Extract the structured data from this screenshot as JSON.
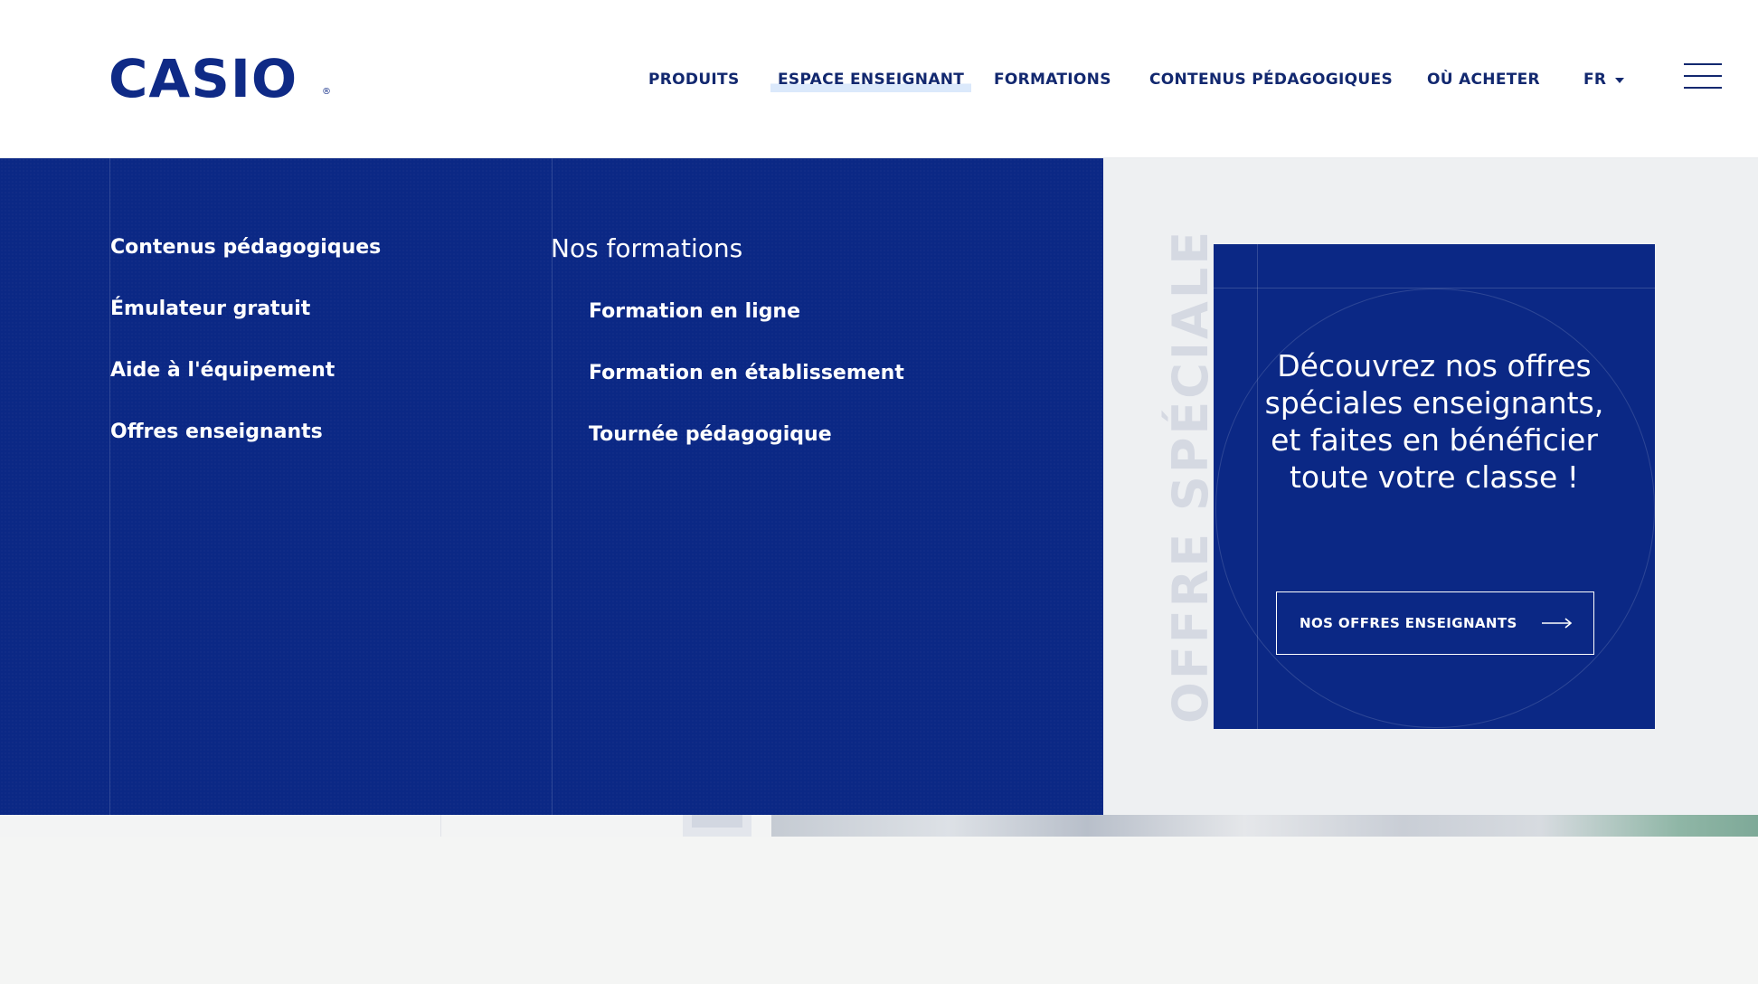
{
  "header": {
    "logo_text": "CASIO",
    "logo_mark": "®",
    "nav": {
      "produits": "PRODUITS",
      "espace_enseignant": "ESPACE ENSEIGNANT",
      "formations": "FORMATIONS",
      "contenus": "CONTENUS PÉDAGOGIQUES",
      "ou_acheter": "OÙ ACHETER",
      "lang": "FR"
    },
    "icons": {
      "lang_caret": "chevron-down-icon",
      "menu": "hamburger-menu-icon"
    }
  },
  "menu": {
    "column1": {
      "contenus": "Contenus pédagogiques",
      "emulateur": "Émulateur gratuit",
      "aide": "Aide à l'équipement",
      "offres": "Offres enseignants"
    },
    "column2": {
      "heading": "Nos formations",
      "en_ligne": "Formation en ligne",
      "etablissement": "Formation en établissement",
      "tournee": "Tournée pédagogique"
    }
  },
  "promo": {
    "vertical_label": "OFFRE SPÉCIALE",
    "text": "Découvrez nos offres spéciales enseignants, et faites en bénéficier toute votre classe !",
    "button_label": "NOS OFFRES ENSEIGNANTS",
    "button_icon": "arrow-right-icon"
  },
  "colors": {
    "brand_blue": "#0b2885",
    "nav_text": "#12286f",
    "active_underline": "#dbe9fb",
    "vertical_label": "#d5d9e2"
  }
}
